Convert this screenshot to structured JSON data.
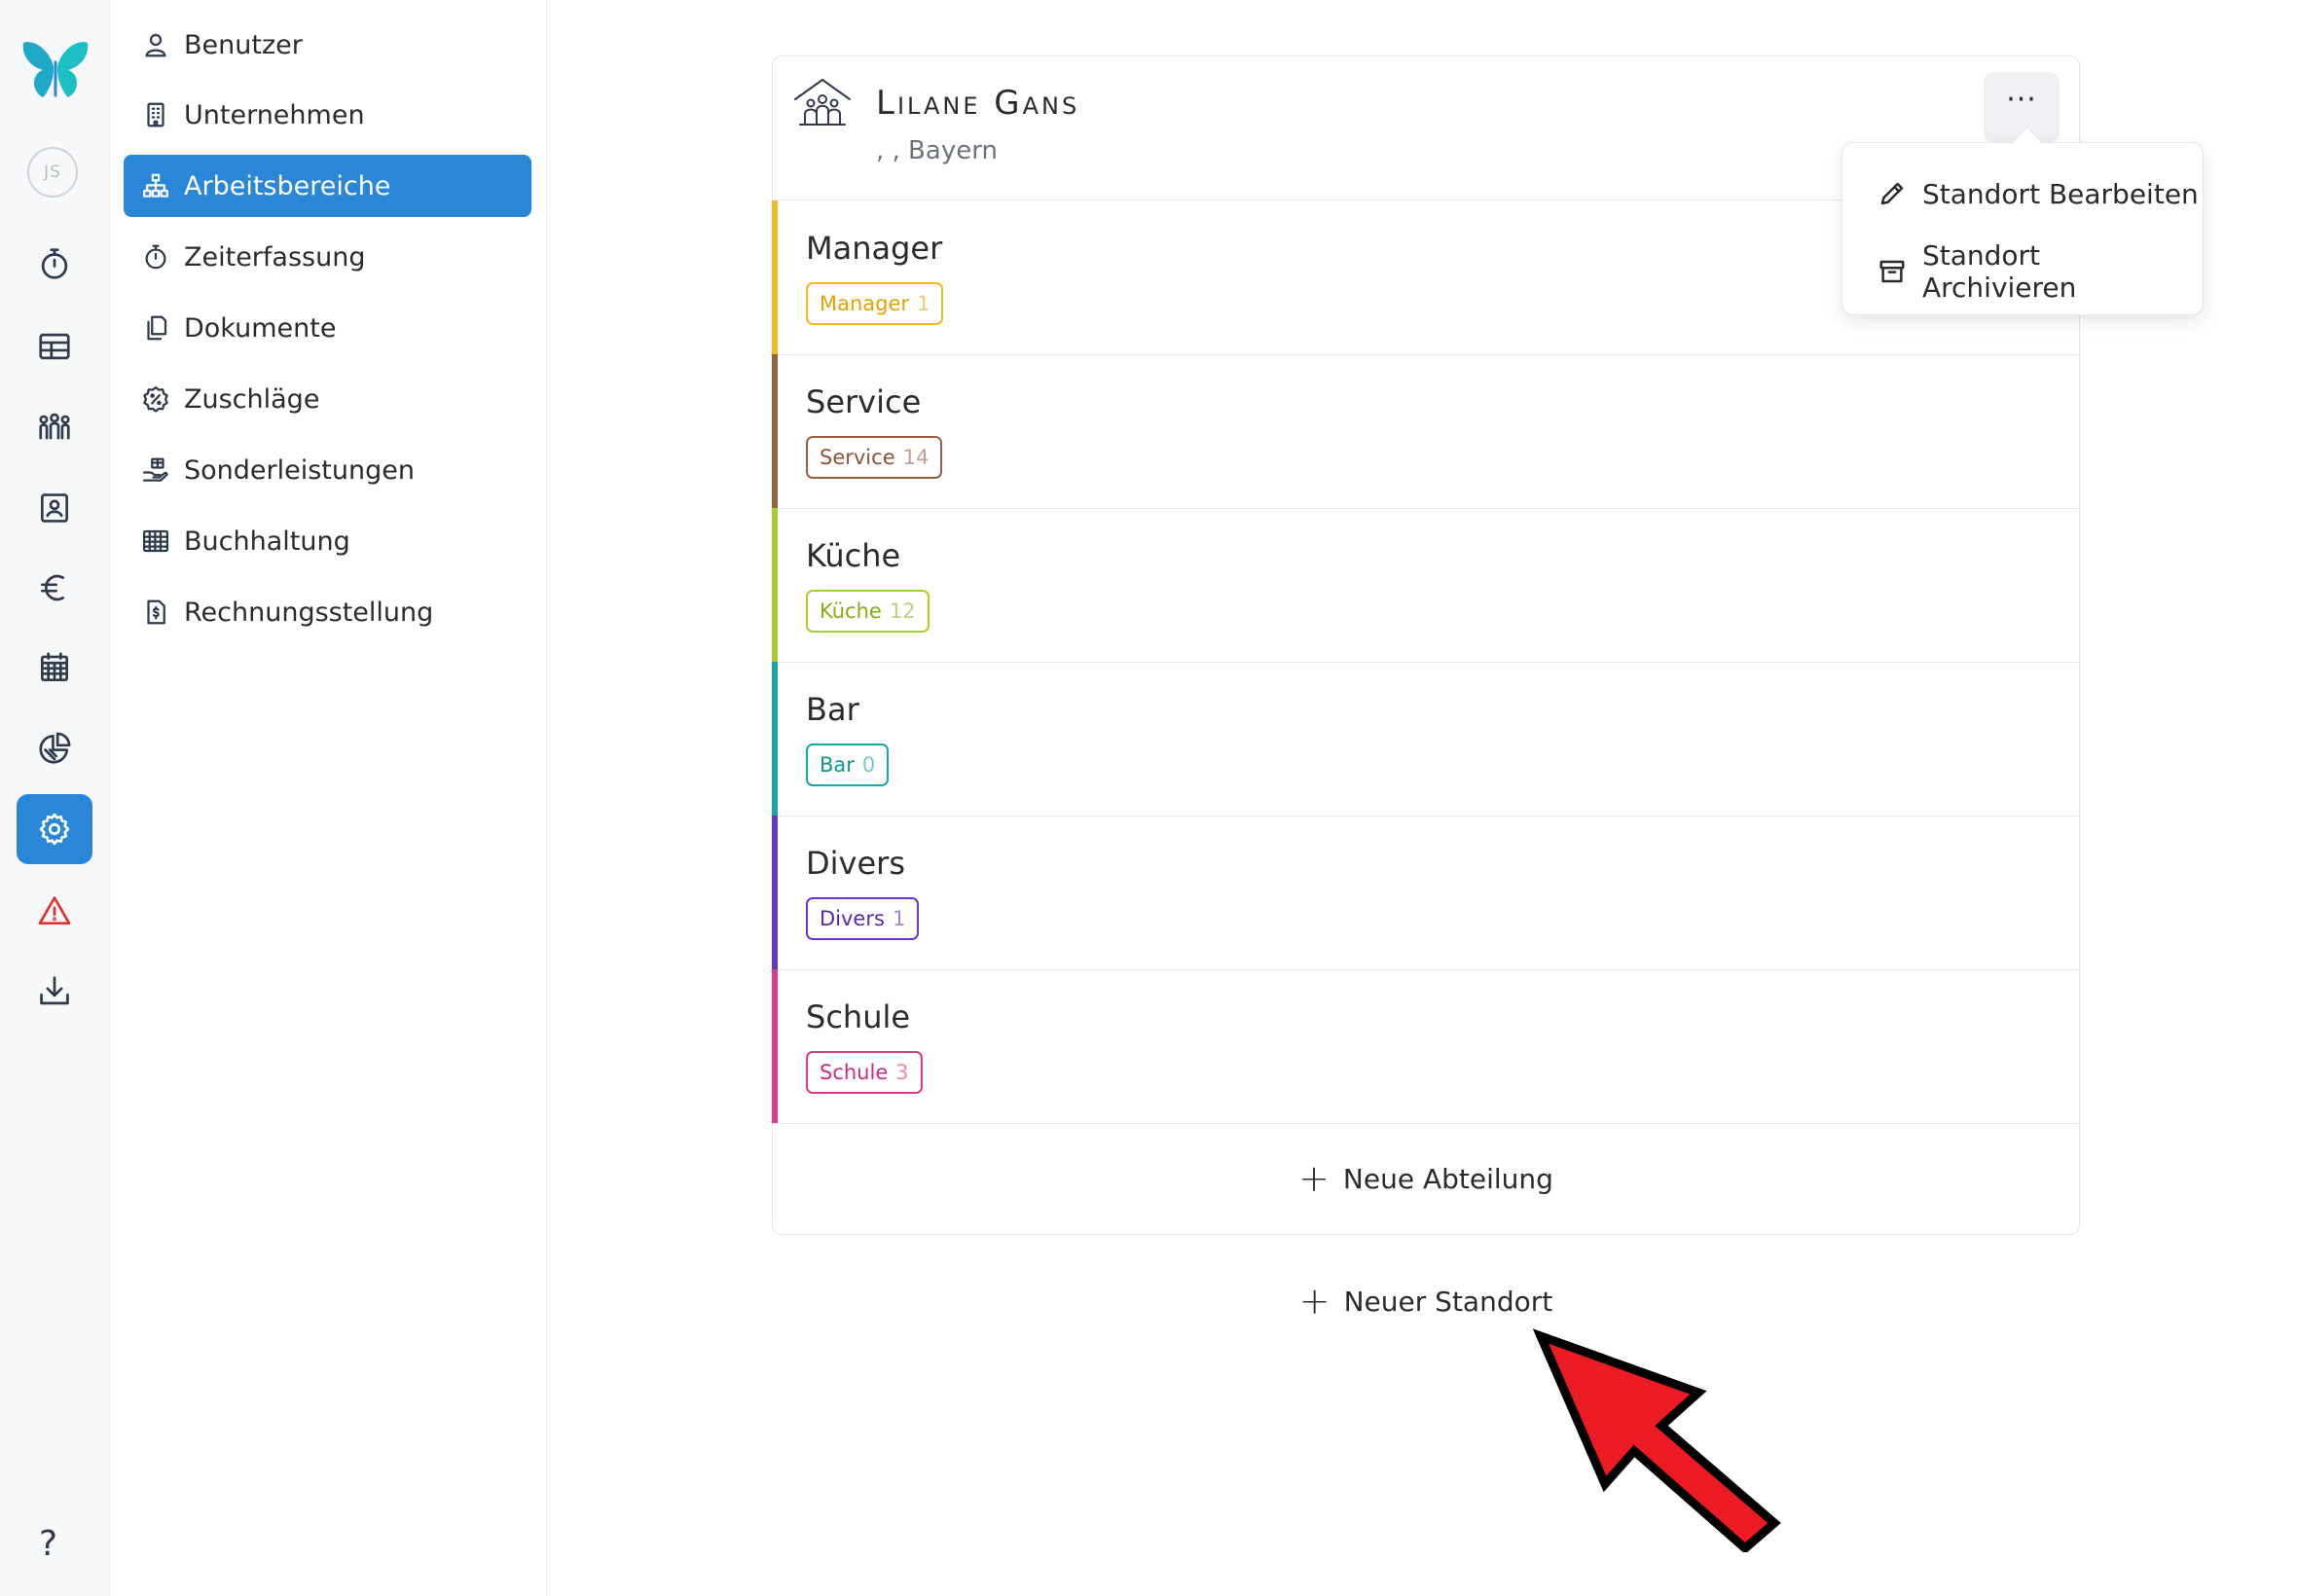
{
  "rail": {
    "avatar_initials": "JS",
    "help": "?",
    "items": [
      {
        "icon": "stopwatch-icon"
      },
      {
        "icon": "table-icon"
      },
      {
        "icon": "team-icon"
      },
      {
        "icon": "contact-card-icon"
      },
      {
        "icon": "euro-icon"
      },
      {
        "icon": "calendar-icon"
      },
      {
        "icon": "pie-chart-icon"
      },
      {
        "icon": "settings-icon",
        "active": true
      },
      {
        "icon": "warning-icon"
      },
      {
        "icon": "download-icon"
      }
    ]
  },
  "settings_menu": {
    "items": [
      {
        "label": "Benutzer",
        "icon": "user-icon"
      },
      {
        "label": "Unternehmen",
        "icon": "building-icon"
      },
      {
        "label": "Arbeitsbereiche",
        "icon": "org-chart-icon",
        "active": true
      },
      {
        "label": "Zeiterfassung",
        "icon": "stopwatch-icon"
      },
      {
        "label": "Dokumente",
        "icon": "documents-icon"
      },
      {
        "label": "Zuschläge",
        "icon": "percent-badge-icon"
      },
      {
        "label": "Sonderleistungen",
        "icon": "hand-gift-icon"
      },
      {
        "label": "Buchhaltung",
        "icon": "ledger-grid-icon"
      },
      {
        "label": "Rechnungsstellung",
        "icon": "invoice-icon"
      }
    ]
  },
  "location": {
    "name": "Lilane Gans",
    "address": ", , Bayern",
    "more_label": "···",
    "departments": [
      {
        "name": "Manager",
        "tag": "Manager",
        "count": "1",
        "color": "#f5b91e"
      },
      {
        "name": "Service",
        "tag": "Service",
        "count": "14",
        "color": "#9a5f3f"
      },
      {
        "name": "Küche",
        "tag": "Küche",
        "count": "12",
        "color": "#a6cf2a"
      },
      {
        "name": "Bar",
        "tag": "Bar",
        "count": "0",
        "color": "#12a9a8"
      },
      {
        "name": "Divers",
        "tag": "Divers",
        "count": "1",
        "color": "#6b35c6"
      },
      {
        "name": "Schule",
        "tag": "Schule",
        "count": "3",
        "color": "#e0378f"
      }
    ],
    "add_department": "Neue Abteilung"
  },
  "add_location": "Neuer Standort",
  "dropdown": {
    "edit": "Standort Bearbeiten",
    "archive": "Standort Archivieren"
  },
  "colors": {
    "accent": "#2a86d6",
    "arrow": "#ed1c24"
  }
}
